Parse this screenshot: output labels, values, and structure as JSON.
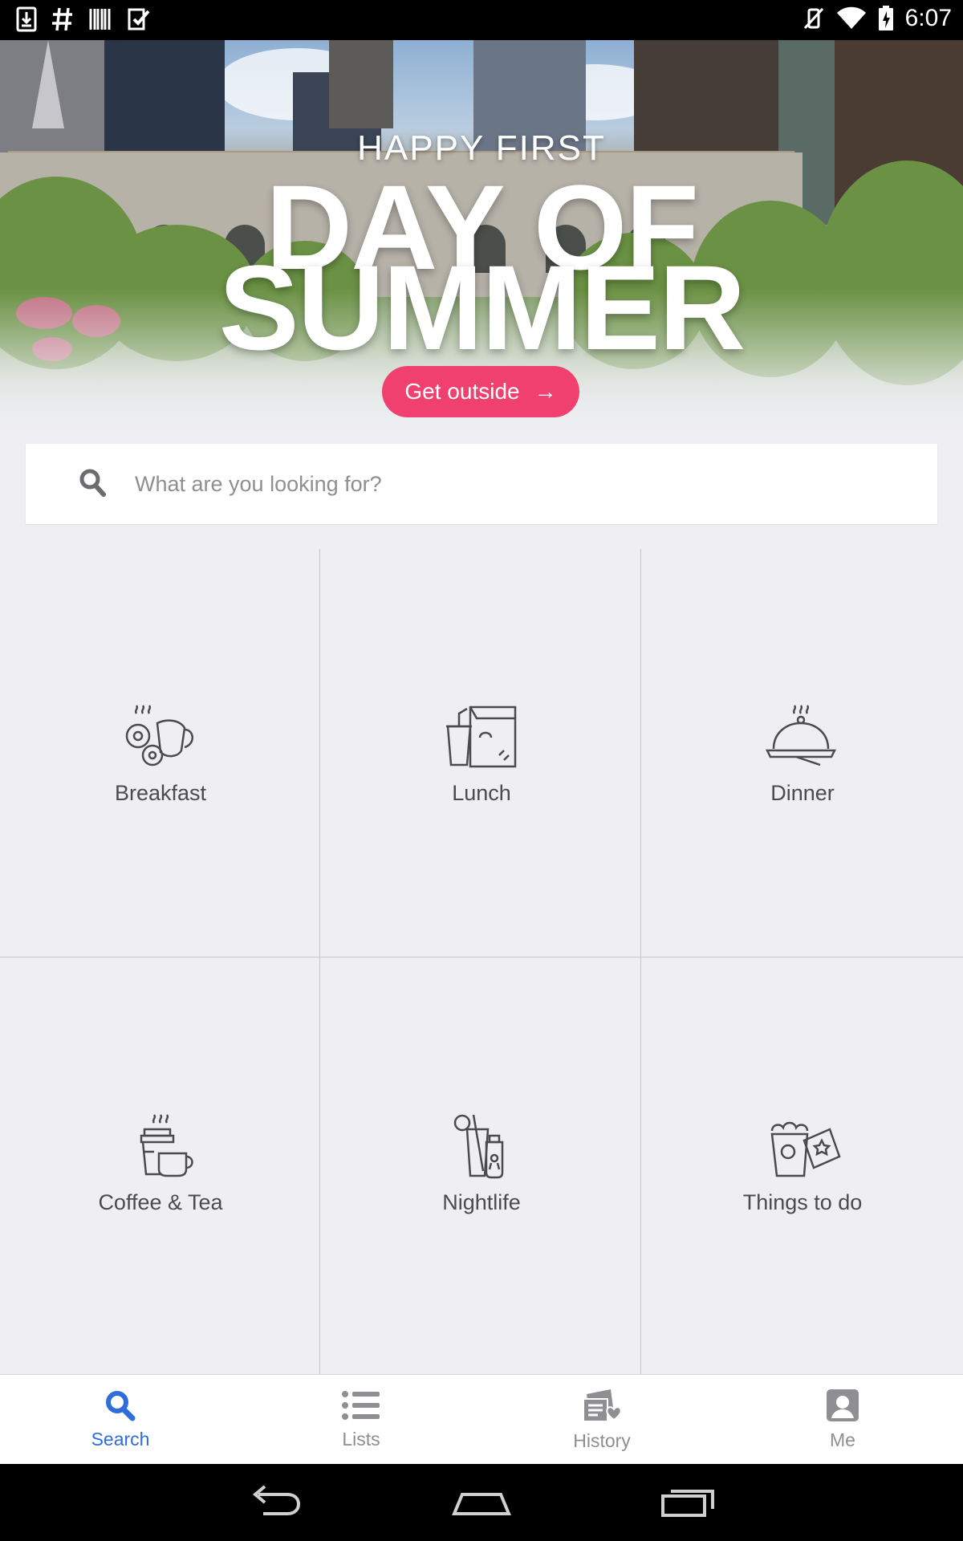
{
  "status_bar": {
    "time": "6:07",
    "left_icons": [
      "download-icon",
      "hash-icon",
      "barcode-icon",
      "checklist-icon"
    ],
    "right_icons": [
      "vibrate-mute-icon",
      "wifi-icon",
      "battery-charging-icon"
    ]
  },
  "hero": {
    "subtitle": "HAPPY FIRST",
    "title_line1": "DAY OF",
    "title_line2": "SUMMER",
    "cta_label": "Get outside",
    "cta_arrow": "→",
    "cta_color": "#f0406f"
  },
  "search": {
    "placeholder": "What are you looking for?",
    "value": ""
  },
  "categories": [
    {
      "label": "Breakfast",
      "icon": "breakfast-icon"
    },
    {
      "label": "Lunch",
      "icon": "lunch-icon"
    },
    {
      "label": "Dinner",
      "icon": "dinner-icon"
    },
    {
      "label": "Coffee & Tea",
      "icon": "coffee-tea-icon"
    },
    {
      "label": "Nightlife",
      "icon": "nightlife-icon"
    },
    {
      "label": "Things to do",
      "icon": "things-to-do-icon"
    }
  ],
  "bottom_nav": {
    "active_color": "#2f6cdc",
    "items": [
      {
        "label": "Search",
        "icon": "search-icon",
        "active": true
      },
      {
        "label": "Lists",
        "icon": "list-icon",
        "active": false
      },
      {
        "label": "History",
        "icon": "history-icon",
        "active": false
      },
      {
        "label": "Me",
        "icon": "profile-icon",
        "active": false
      }
    ]
  },
  "system_nav": [
    "back-icon",
    "home-icon",
    "recents-icon"
  ]
}
